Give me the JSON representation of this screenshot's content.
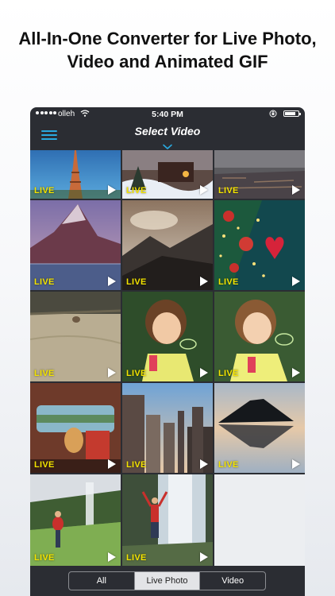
{
  "headline": {
    "line1": "All-In-One Converter for Live Photo,",
    "line2": "Video and Animated GIF"
  },
  "status_bar": {
    "carrier": "olleh",
    "time": "5:40 PM",
    "battery_level": 0.8,
    "icons": [
      "signal-dots-icon",
      "wifi-icon",
      "rotation-lock-icon",
      "battery-icon"
    ]
  },
  "nav": {
    "title": "Select Video",
    "menu_icon": "hamburger-menu-icon",
    "chevron_icon": "chevron-down-icon",
    "accent_color": "#29a9e0"
  },
  "badge_label": "LIVE",
  "grid": {
    "items": [
      {
        "name": "eiffel-tower",
        "badge": "LIVE"
      },
      {
        "name": "snowy-cabin",
        "badge": "LIVE"
      },
      {
        "name": "city-aerial",
        "badge": "LIVE"
      },
      {
        "name": "mountain-lake",
        "badge": "LIVE"
      },
      {
        "name": "misty-mountains",
        "badge": "LIVE"
      },
      {
        "name": "christmas-tree",
        "badge": "LIVE"
      },
      {
        "name": "dog-on-grass",
        "badge": "LIVE"
      },
      {
        "name": "girl-blowing-bubbles-1",
        "badge": "LIVE"
      },
      {
        "name": "girl-blowing-bubbles-2",
        "badge": "LIVE"
      },
      {
        "name": "vintage-van-interior",
        "badge": "LIVE"
      },
      {
        "name": "new-york-skyline",
        "badge": "LIVE"
      },
      {
        "name": "lake-mountain-reflection",
        "badge": "LIVE"
      },
      {
        "name": "hiker-near-waterfall",
        "badge": "LIVE"
      },
      {
        "name": "person-under-waterfall",
        "badge": "LIVE"
      }
    ]
  },
  "tabs": {
    "items": [
      {
        "label": "All",
        "selected": false
      },
      {
        "label": "Live Photo",
        "selected": true
      },
      {
        "label": "Video",
        "selected": false
      }
    ]
  },
  "colors": {
    "background": "#2b2d33",
    "live_badge": "#f4e400",
    "selected_segment": "#e3e4e7"
  }
}
